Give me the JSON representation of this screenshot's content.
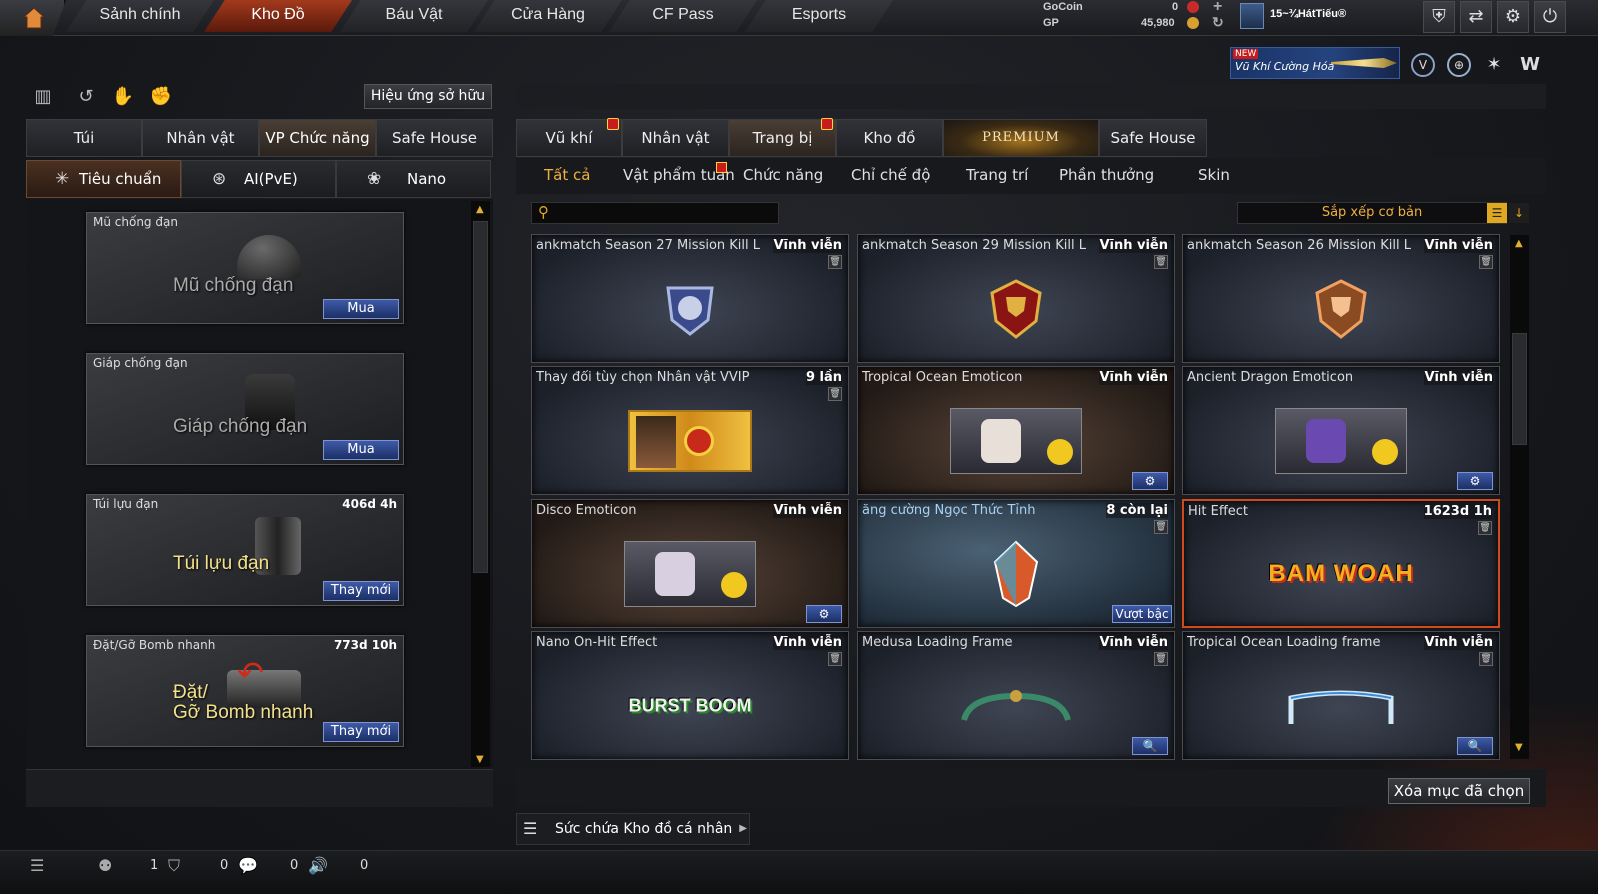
{
  "topnav": {
    "tabs": [
      "Sảnh chính",
      "Kho Đồ",
      "Báu Vật",
      "Cửa Hàng",
      "CF Pass",
      "Esports"
    ],
    "active": 1
  },
  "currency": {
    "gocoin_label": "GoCoin",
    "gp_label": "GP",
    "gocoin_value": "0",
    "gp_value": "45,980"
  },
  "profile": {
    "name": "15~¾HátTiếu®"
  },
  "promo": {
    "new_badge": "NEW",
    "text": "Vũ Khí Cường Hóa"
  },
  "left": {
    "effect_button": "Hiệu ứng sở hữu",
    "tabs": [
      "Túi",
      "Nhân vật",
      "VP Chức năng",
      "Safe House"
    ],
    "active_tab": 2,
    "subtabs": [
      "Tiêu chuẩn",
      "AI(PvE)",
      "Nano"
    ],
    "active_subtab": 0,
    "items": [
      {
        "title": "Mũ chống đạn",
        "big": "Mũ chống đạn",
        "duration": "",
        "button": "Mua"
      },
      {
        "title": "Giáp chống đạn",
        "big": "Giáp chống đạn",
        "duration": "",
        "button": "Mua"
      },
      {
        "title": "Túi lựu đạn",
        "big": "Túi lựu đạn",
        "duration": "406d 4h",
        "button": "Thay mới"
      },
      {
        "title": "Đặt/Gỡ Bomb nhanh",
        "big1": "Đặt/",
        "big2": "Gỡ Bomb nhanh",
        "duration": "773d 10h",
        "button": "Thay mới"
      }
    ]
  },
  "right": {
    "tabs": [
      "Vũ khí",
      "Nhân vật",
      "Trang bị",
      "Kho đồ",
      "PREMIUM",
      "Safe House"
    ],
    "active_tab": 2,
    "subtabs": [
      "Tất cả",
      "Vật phẩm tuần",
      "Chức năng",
      "Chỉ chế độ",
      "Trang trí",
      "Phần thưởng",
      "Skin"
    ],
    "active_subtab": 0,
    "search_placeholder": "",
    "sort_label": "Sắp xếp cơ bản",
    "items": [
      {
        "name": "ankmatch Season 27 Mission Kill L",
        "period": "Vĩnh viễn"
      },
      {
        "name": "ankmatch Season 29 Mission Kill L",
        "period": "Vĩnh viễn"
      },
      {
        "name": "ankmatch Season 26 Mission Kill L",
        "period": "Vĩnh viễn"
      },
      {
        "name": "Thay đổi tùy chọn Nhân vật VVIP",
        "period": "9 lần"
      },
      {
        "name": "Tropical Ocean Emoticon",
        "period": "Vĩnh viễn"
      },
      {
        "name": "Ancient Dragon Emoticon",
        "period": "Vĩnh viễn"
      },
      {
        "name": "Disco Emoticon",
        "period": "Vĩnh viễn"
      },
      {
        "name": "ăng cường Ngọc Thức Tỉnh",
        "period": "8 còn lại",
        "button": "Vượt bậc"
      },
      {
        "name": "Hit Effect",
        "period": "1623d 1h"
      },
      {
        "name": "Nano On-Hit Effect",
        "period": "Vĩnh viễn"
      },
      {
        "name": "Medusa Loading Frame",
        "period": "Vĩnh viễn"
      },
      {
        "name": "Tropical Ocean Loading frame",
        "period": "Vĩnh viễn"
      }
    ],
    "hit_effect_text": "BAM WOAH",
    "nano_text": "BURST BOOM",
    "delete_button": "Xóa mục đã chọn",
    "capacity": "Sức chứa Kho đồ cá nhân"
  },
  "bottom": {
    "counts": [
      "1",
      "0",
      "0",
      "0"
    ]
  }
}
